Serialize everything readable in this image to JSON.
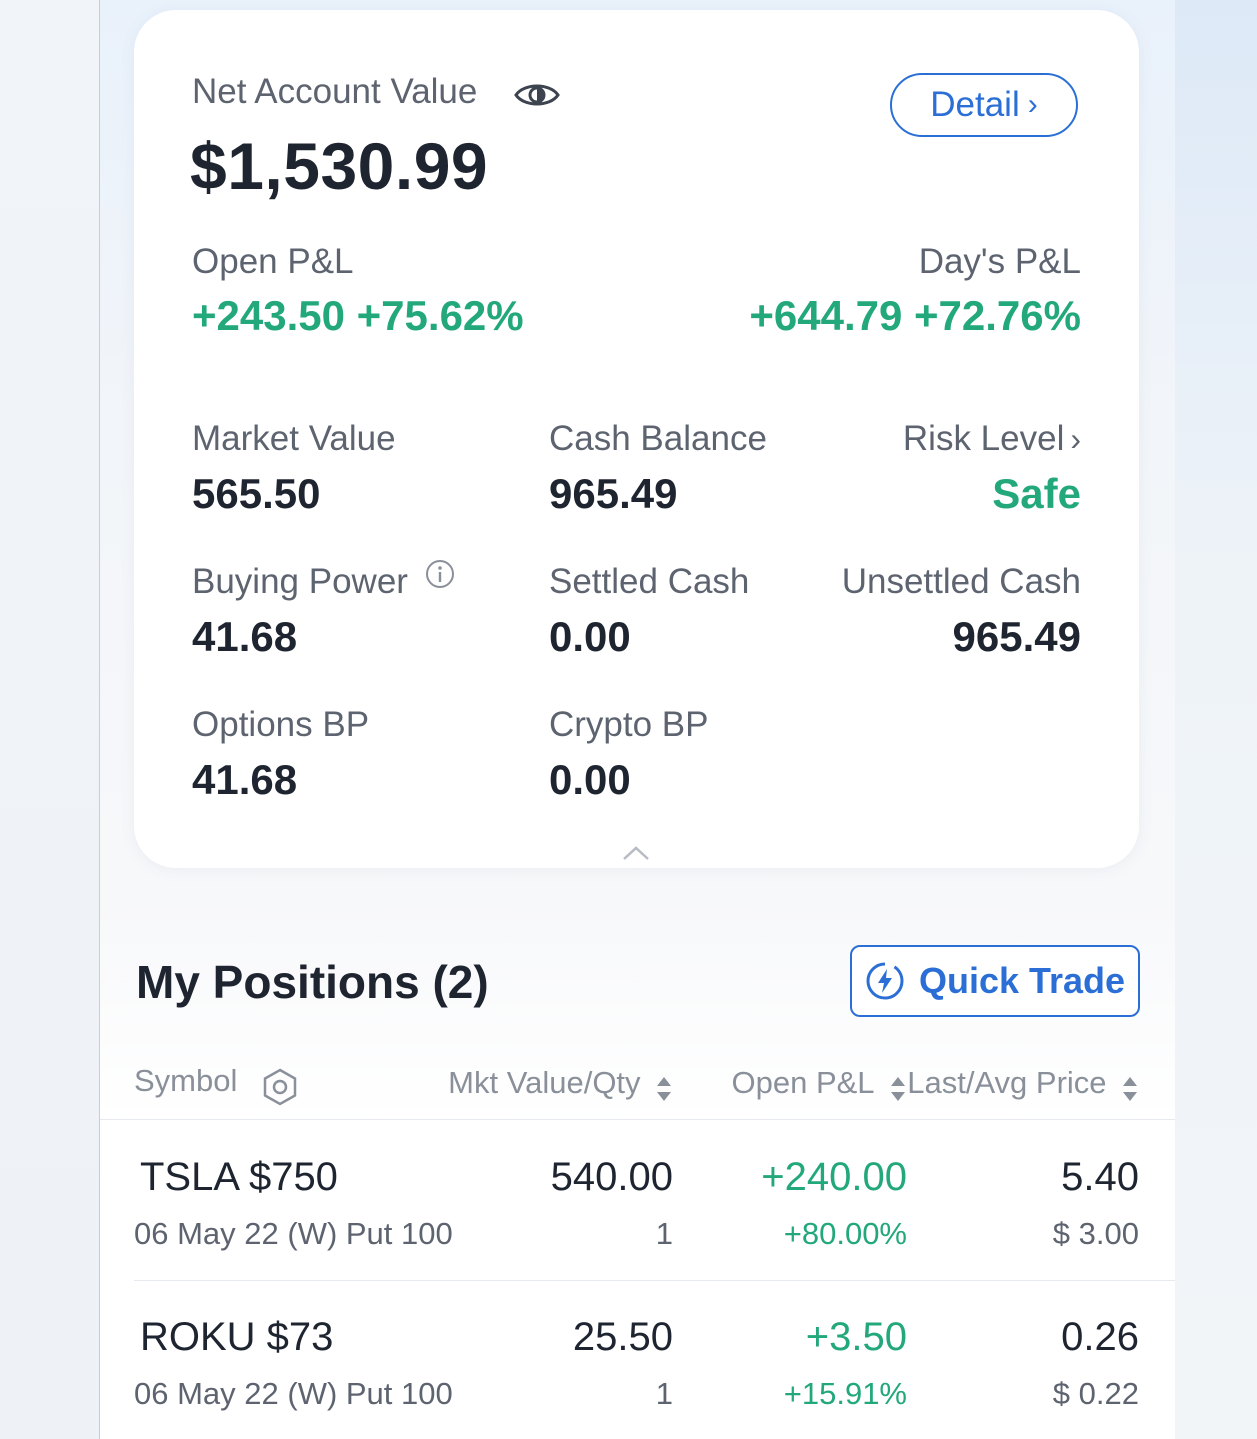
{
  "account": {
    "net_value_label": "Net Account Value",
    "net_value": "$1,530.99",
    "detail_label": "Detail",
    "open_pl_label": "Open P&L",
    "open_pl_value": "+243.50 +75.62%",
    "days_pl_label": "Day's P&L",
    "days_pl_value": "+644.79 +72.76%",
    "market_value_label": "Market Value",
    "market_value": "565.50",
    "cash_balance_label": "Cash Balance",
    "cash_balance": "965.49",
    "risk_level_label": "Risk Level",
    "risk_level": "Safe",
    "buying_power_label": "Buying Power",
    "buying_power": "41.68",
    "settled_cash_label": "Settled Cash",
    "settled_cash": "0.00",
    "unsettled_cash_label": "Unsettled Cash",
    "unsettled_cash": "965.49",
    "options_bp_label": "Options BP",
    "options_bp": "41.68",
    "crypto_bp_label": "Crypto BP",
    "crypto_bp": "0.00"
  },
  "positions": {
    "title": "My Positions (2)",
    "quick_trade_label": "Quick Trade",
    "columns": {
      "symbol": "Symbol",
      "mkt_value_qty": "Mkt Value/Qty",
      "open_pl": "Open P&L",
      "last_avg_price": "Last/Avg Price"
    },
    "rows": [
      {
        "symbol": "TSLA $750",
        "contract": "06 May 22 (W) Put 100",
        "mkt_value": "540.00",
        "qty": "1",
        "open_pl": "+240.00",
        "open_pl_pct": "+80.00%",
        "last": "5.40",
        "avg": "$ 3.00"
      },
      {
        "symbol": "ROKU $73",
        "contract": "06 May 22 (W) Put 100",
        "mkt_value": "25.50",
        "qty": "1",
        "open_pl": "+3.50",
        "open_pl_pct": "+15.91%",
        "last": "0.26",
        "avg": "$ 0.22"
      }
    ]
  },
  "colors": {
    "accent": "#2b6fd6",
    "positive": "#22a87a",
    "text": "#1f2530",
    "muted": "#5d6470"
  },
  "icons": [
    "eye-icon",
    "chevron-right-icon",
    "info-icon",
    "chevron-up-icon",
    "lightning-icon",
    "settings-icon",
    "sort-icon"
  ]
}
